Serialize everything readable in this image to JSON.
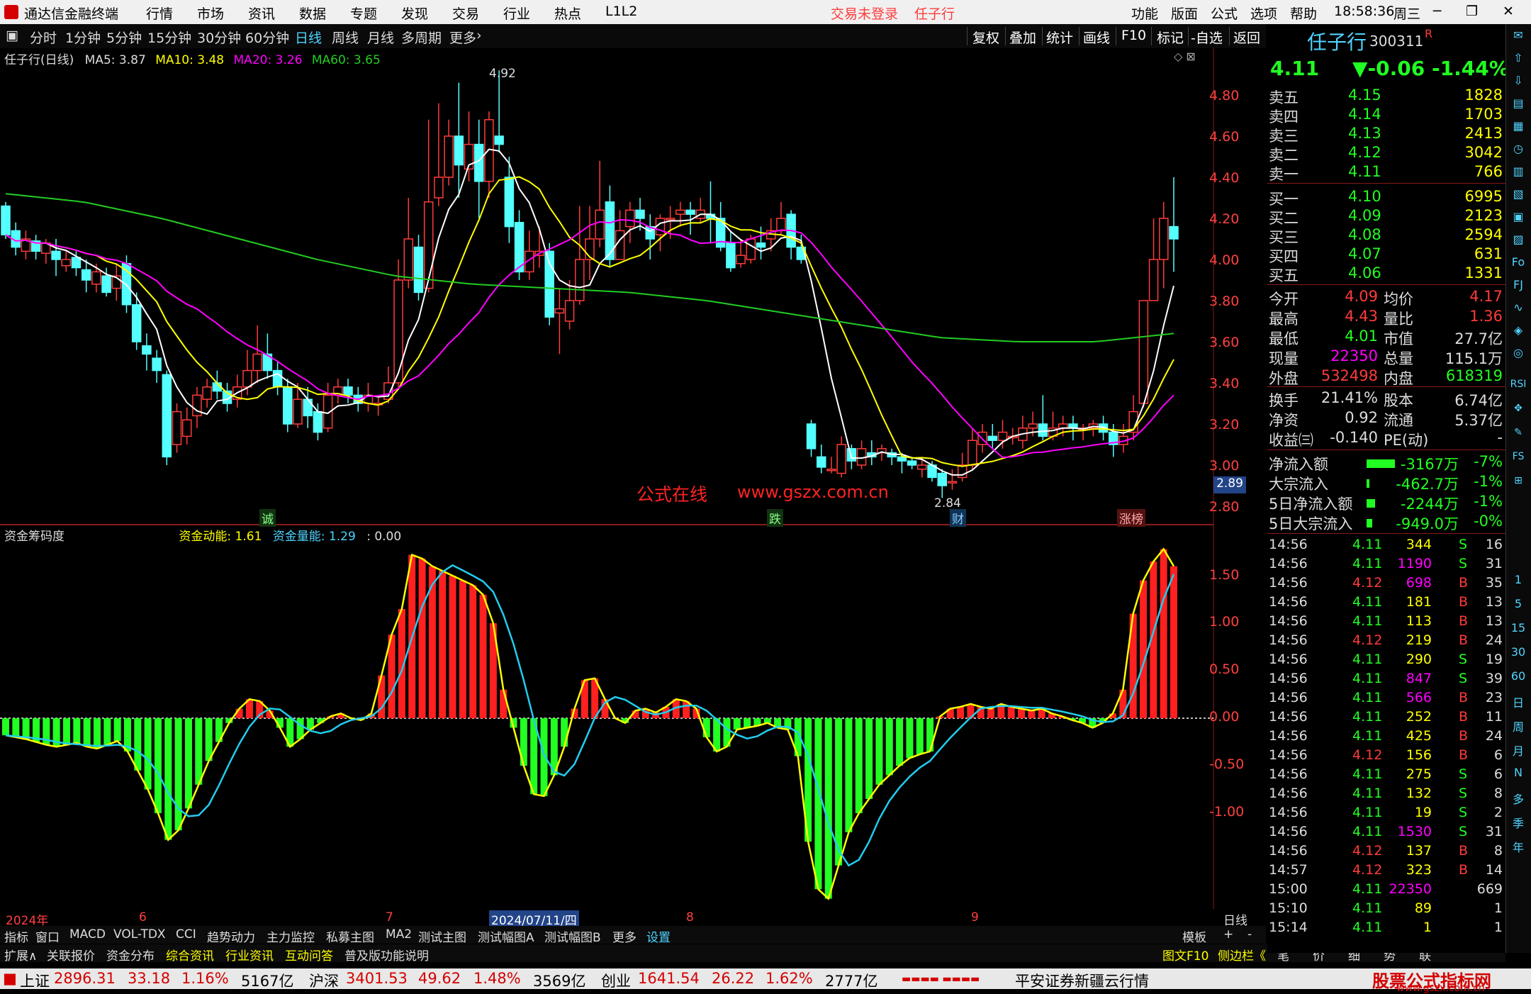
{
  "menubar": {
    "app_title": "通达信金融终端",
    "menus": [
      "行情",
      "市场",
      "资讯",
      "数据",
      "专题",
      "发现",
      "交易",
      "行业",
      "热点",
      "L1L2"
    ],
    "trade_status": "交易未登录",
    "stock_name": "任子行",
    "right_menus": [
      "功能",
      "版面",
      "公式",
      "选项",
      "帮助"
    ],
    "time": "18:58:36",
    "weekday": "周三"
  },
  "toolbar": {
    "periods": [
      "分时",
      "1分钟",
      "5分钟",
      "15分钟",
      "30分钟",
      "60分钟",
      "日线",
      "周线",
      "月线",
      "多周期",
      "更多"
    ],
    "active": "日线",
    "right_buttons": [
      "复权",
      "叠加",
      "统计",
      "画线",
      "F10",
      "标记",
      "-自选",
      "返回"
    ]
  },
  "chart_info": {
    "title": "任子行(日线)",
    "ma5": "MA5: 3.87",
    "ma10": "MA10: 3.48",
    "ma20": "MA20: 3.26",
    "ma60": "MA60: 3.65",
    "high_marker": "4.92",
    "low_marker": "2.84",
    "last_price_tag": "2.89",
    "watermark_a": "公式在线",
    "watermark_b": "www.gszx.com.cn",
    "event_marks": [
      "诚",
      "跌",
      "财",
      "涨榜"
    ],
    "price_ticks": [
      "4.80",
      "4.60",
      "4.40",
      "4.20",
      "4.00",
      "3.80",
      "3.60",
      "3.40",
      "3.20",
      "3.00",
      "2.80"
    ]
  },
  "indicator": {
    "title": "资金筹码度",
    "line1": "资金动能: 1.61",
    "line2": "资金量能: 1.29",
    "line3": ": 0.00",
    "ticks": [
      "1.50",
      "1.00",
      "0.50",
      "0.00",
      "-0.50",
      "-1.00"
    ]
  },
  "date_axis": {
    "labels": [
      "2024年",
      "6",
      "7",
      "2024/07/11/四",
      "8",
      "9"
    ],
    "period": "日线"
  },
  "bottom_tabs": [
    "指标",
    "窗口",
    "MACD",
    "VOL-TDX",
    "CCI",
    "趋势动力",
    "主力监控",
    "私募主图",
    "MA2",
    "测试主图",
    "测试幅图A",
    "测试幅图B",
    "更多",
    "设置"
  ],
  "bottom_right": [
    "模板",
    "+",
    "-"
  ],
  "bottom_tabs2": [
    "扩展∧",
    "关联报价",
    "资金分布",
    "综合资讯",
    "行业资讯",
    "互动问答",
    "普及版功能说明"
  ],
  "bottom_right2": [
    "图文F10",
    "侧边栏《",
    "笔",
    "价",
    "细",
    "势",
    "联"
  ],
  "quote": {
    "name": "任子行",
    "code": "300311",
    "badge": "R",
    "price": "4.11",
    "change": "▼-0.06",
    "pct": "-1.44%",
    "asks": [
      {
        "label": "卖五",
        "price": "4.15",
        "vol": "1828"
      },
      {
        "label": "卖四",
        "price": "4.14",
        "vol": "1703"
      },
      {
        "label": "卖三",
        "price": "4.13",
        "vol": "2413"
      },
      {
        "label": "卖二",
        "price": "4.12",
        "vol": "3042"
      },
      {
        "label": "卖一",
        "price": "4.11",
        "vol": "766"
      }
    ],
    "bids": [
      {
        "label": "买一",
        "price": "4.10",
        "vol": "6995"
      },
      {
        "label": "买二",
        "price": "4.09",
        "vol": "2123"
      },
      {
        "label": "买三",
        "price": "4.08",
        "vol": "2594"
      },
      {
        "label": "买四",
        "price": "4.07",
        "vol": "631"
      },
      {
        "label": "买五",
        "price": "4.06",
        "vol": "1331"
      }
    ],
    "stats": [
      {
        "l1": "今开",
        "v1": "4.09",
        "l2": "均价",
        "v2": "4.17"
      },
      {
        "l1": "最高",
        "v1": "4.43",
        "l2": "量比",
        "v2": "1.36"
      },
      {
        "l1": "最低",
        "v1": "4.01",
        "l2": "市值",
        "v2": "27.7亿"
      },
      {
        "l1": "现量",
        "v1": "22350",
        "l2": "总量",
        "v2": "115.1万"
      },
      {
        "l1": "外盘",
        "v1": "532498",
        "l2": "内盘",
        "v2": "618319"
      },
      {
        "l1": "换手",
        "v1": "21.41%",
        "l2": "股本",
        "v2": "6.74亿"
      },
      {
        "l1": "净资",
        "v1": "0.92",
        "l2": "流通",
        "v2": "5.37亿"
      },
      {
        "l1": "收益㈢",
        "v1": "-0.140",
        "l2": "PE(动)",
        "v2": "-"
      }
    ],
    "flows": [
      {
        "label": "净流入额",
        "value": "-3167万",
        "pct": "-7%"
      },
      {
        "label": "大宗流入",
        "value": "-462.7万",
        "pct": "-1%"
      },
      {
        "label": "5日净流入额",
        "value": "-2244万",
        "pct": "-1%"
      },
      {
        "label": "5日大宗流入",
        "value": "-949.0万",
        "pct": "-0%"
      }
    ],
    "ticks": [
      {
        "t": "14:56",
        "p": "4.11",
        "v": "344",
        "bs": "S",
        "n": "16"
      },
      {
        "t": "14:56",
        "p": "4.11",
        "v": "1190",
        "bs": "S",
        "n": "31"
      },
      {
        "t": "14:56",
        "p": "4.12",
        "v": "698",
        "bs": "B",
        "n": "35"
      },
      {
        "t": "14:56",
        "p": "4.11",
        "v": "181",
        "bs": "B",
        "n": "13"
      },
      {
        "t": "14:56",
        "p": "4.11",
        "v": "113",
        "bs": "B",
        "n": "13"
      },
      {
        "t": "14:56",
        "p": "4.12",
        "v": "219",
        "bs": "B",
        "n": "24"
      },
      {
        "t": "14:56",
        "p": "4.11",
        "v": "290",
        "bs": "S",
        "n": "19"
      },
      {
        "t": "14:56",
        "p": "4.11",
        "v": "847",
        "bs": "S",
        "n": "39"
      },
      {
        "t": "14:56",
        "p": "4.11",
        "v": "566",
        "bs": "B",
        "n": "23"
      },
      {
        "t": "14:56",
        "p": "4.11",
        "v": "252",
        "bs": "B",
        "n": "11"
      },
      {
        "t": "14:56",
        "p": "4.11",
        "v": "425",
        "bs": "B",
        "n": "24"
      },
      {
        "t": "14:56",
        "p": "4.12",
        "v": "156",
        "bs": "B",
        "n": "6"
      },
      {
        "t": "14:56",
        "p": "4.11",
        "v": "275",
        "bs": "S",
        "n": "6"
      },
      {
        "t": "14:56",
        "p": "4.11",
        "v": "132",
        "bs": "S",
        "n": "8"
      },
      {
        "t": "14:56",
        "p": "4.11",
        "v": "19",
        "bs": "S",
        "n": "2"
      },
      {
        "t": "14:56",
        "p": "4.11",
        "v": "1530",
        "bs": "S",
        "n": "31"
      },
      {
        "t": "14:56",
        "p": "4.12",
        "v": "137",
        "bs": "B",
        "n": "8"
      },
      {
        "t": "14:57",
        "p": "4.12",
        "v": "323",
        "bs": "B",
        "n": "14"
      },
      {
        "t": "15:00",
        "p": "4.11",
        "v": "22350",
        "bs": "",
        "n": "669"
      },
      {
        "t": "15:10",
        "p": "4.11",
        "v": "89",
        "bs": "",
        "n": "1"
      },
      {
        "t": "15:14",
        "p": "4.11",
        "v": "1",
        "bs": "",
        "n": "1"
      }
    ]
  },
  "sidebar_labels": [
    "1",
    "5",
    "15",
    "30",
    "60",
    "日",
    "周",
    "月",
    "N",
    "多",
    "季",
    "年"
  ],
  "status": {
    "sh_label": "上证",
    "sh_val": "2896.31",
    "sh_chg": "33.18",
    "sh_pct": "1.16%",
    "sh_amt": "5167亿",
    "sz_label": "沪深",
    "sz_val": "3401.53",
    "sz_chg": "49.62",
    "sz_pct": "1.48%",
    "sz_amt": "3569亿",
    "cy_label": "创业",
    "cy_val": "1641.54",
    "cy_chg": "26.22",
    "cy_pct": "1.62%",
    "cy_amt": "2777亿",
    "broker": "平安证券新疆云行情",
    "site_logo": "股票公式指标网",
    "site_url": "www.gszx.com.cn"
  },
  "colors": {
    "up": "#ff3b3b",
    "down": "#54ffff",
    "ma5": "#ffffff",
    "ma10": "#ffff00",
    "ma20": "#ff00ff",
    "ma60": "#22cc22"
  }
}
